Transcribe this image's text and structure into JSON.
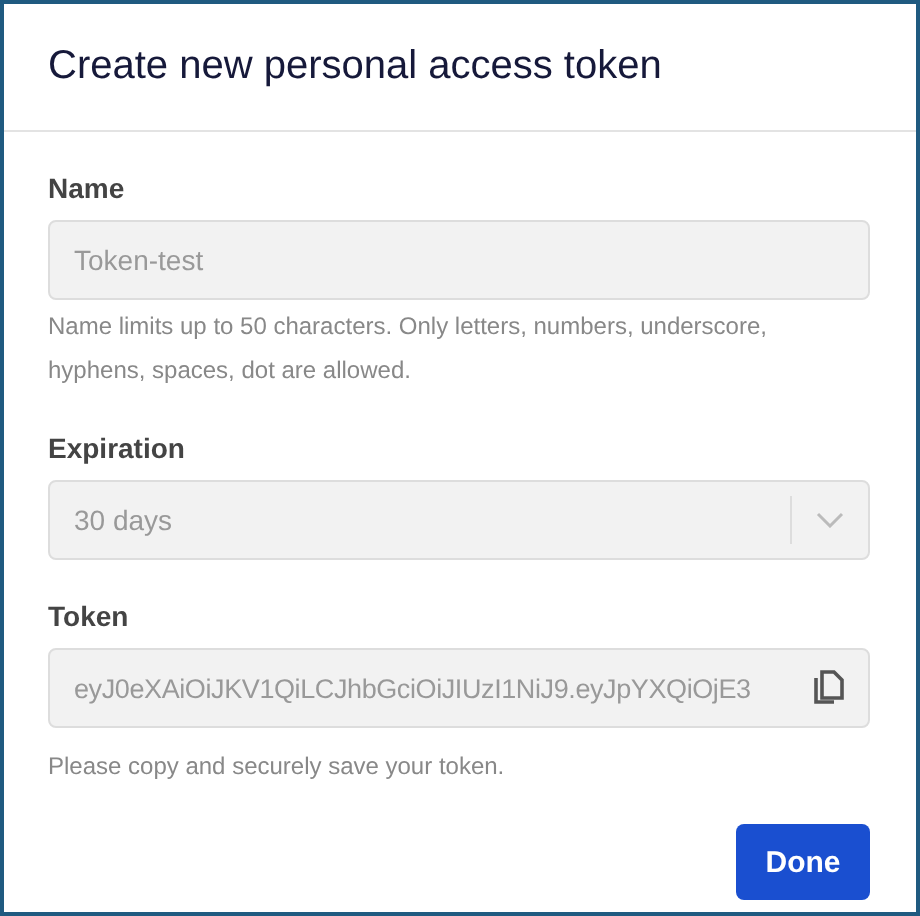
{
  "dialog": {
    "title": "Create new personal access token"
  },
  "fields": [
    {
      "kind": "text",
      "label": "Name",
      "value": "Token-test",
      "disabled": true,
      "help": "Name limits up to 50 characters. Only letters, numbers, underscore, hyphens, spaces, dot are allowed."
    },
    {
      "kind": "select",
      "label": "Expiration",
      "value": "30 days",
      "disabled": true
    },
    {
      "kind": "copy",
      "label": "Token",
      "value": "eyJ0eXAiOiJKV1QiLCJhbGciOiJIUzI1NiJ9.eyJpYXQiOjE3",
      "disabled": true,
      "help": "Please copy and securely save your token."
    }
  ],
  "buttons": [
    "Done"
  ]
}
